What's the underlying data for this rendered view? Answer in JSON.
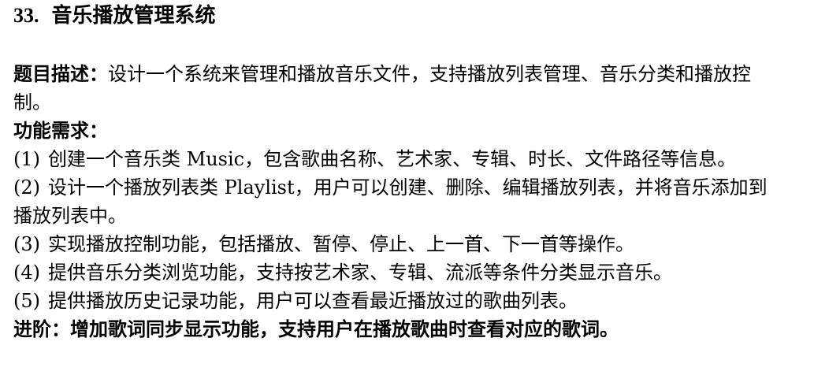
{
  "doc": {
    "number": "33.",
    "title": "音乐播放管理系统",
    "description_label": "题目描述：",
    "description_text": "设计一个系统来管理和播放音乐文件，支持播放列表管理、音乐分类和播放控制。",
    "requirements_label": "功能需求：",
    "requirements": [
      {
        "index": "(1)",
        "text": "创建一个音乐类 Music，包含歌曲名称、艺术家、专辑、时长、文件路径等信息。"
      },
      {
        "index": "(2)",
        "text": "设计一个播放列表类 Playlist，用户可以创建、删除、编辑播放列表，并将音乐添加到播放列表中。"
      },
      {
        "index": "(3)",
        "text": "实现播放控制功能，包括播放、暂停、停止、上一首、下一首等操作。"
      },
      {
        "index": "(4)",
        "text": "提供音乐分类浏览功能，支持按艺术家、专辑、流派等条件分类显示音乐。"
      },
      {
        "index": "(5)",
        "text": "提供播放历史记录功能，用户可以查看最近播放过的歌曲列表。"
      }
    ],
    "advanced_label": "进阶：",
    "advanced_text": "增加歌词同步显示功能，支持用户在播放歌曲时查看对应的歌词。"
  }
}
